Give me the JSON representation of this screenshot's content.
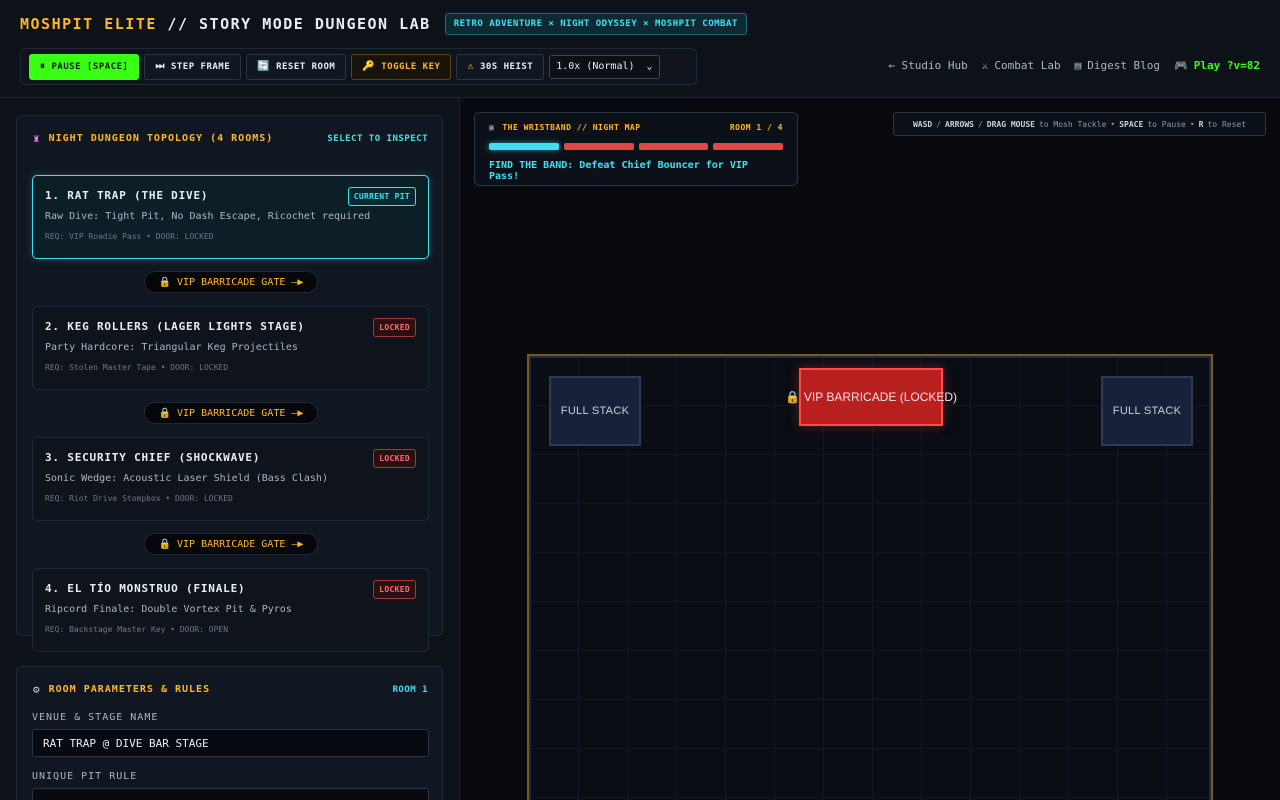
{
  "header": {
    "brand": "MOSHPIT ELITE",
    "title_rest": " // STORY MODE DUNGEON LAB",
    "tagline": "RETRO ADVENTURE × NIGHT ODYSSEY × MOSHPIT COMBAT"
  },
  "toolbar": {
    "pause": "PAUSE [SPACE]",
    "step": "STEP FRAME",
    "reset": "RESET ROOM",
    "toggle_key": "TOGGLE KEY",
    "heist": "30S HEIST",
    "speed": "1.0x (Normal)"
  },
  "nav": {
    "studio": "← Studio Hub",
    "combat": "Combat Lab",
    "digest": "Digest Blog",
    "play": "Play ?v=82"
  },
  "topology": {
    "title": "NIGHT DUNGEON TOPOLOGY (4 ROOMS)",
    "hint": "SELECT TO INSPECT",
    "gate_label": "VIP BARRICADE GATE",
    "rooms": [
      {
        "name": "1. RAT TRAP (THE DIVE)",
        "desc": "Raw Dive: Tight Pit, No Dash Escape, Ricochet required",
        "req": "REQ: VIP Roadie Pass  •  DOOR: LOCKED",
        "badge": "CURRENT PIT"
      },
      {
        "name": "2. KEG ROLLERS (LAGER LIGHTS STAGE)",
        "desc": "Party Hardcore: Triangular Keg Projectiles",
        "req": "REQ: Stolen Master Tape  •  DOOR: LOCKED",
        "badge": "LOCKED"
      },
      {
        "name": "3. SECURITY CHIEF (SHOCKWAVE)",
        "desc": "Sonic Wedge: Acoustic Laser Shield (Bass Clash)",
        "req": "REQ: Riot Drive Stompbox  •  DOOR: LOCKED",
        "badge": "LOCKED"
      },
      {
        "name": "4. EL TÍO MONSTRUO (FINALE)",
        "desc": "Ripcord Finale: Double Vortex Pit & Pyros",
        "req": "REQ: Backstage Master Key  •  DOOR: OPEN",
        "badge": "LOCKED"
      }
    ]
  },
  "params": {
    "title": "ROOM PARAMETERS & RULES",
    "room": "ROOM 1",
    "venue_label": "VENUE & STAGE NAME",
    "venue_value": "RAT TRAP @ DIVE BAR STAGE",
    "rule_label": "UNIQUE PIT RULE"
  },
  "map": {
    "title": "THE WRISTBAND // NIGHT MAP",
    "room": "ROOM 1 / 4",
    "progress_current": 1,
    "progress_total": 4,
    "objective": "FIND THE BAND: Defeat Chief Bouncer for VIP Pass!"
  },
  "controls": {
    "k1": "WASD",
    "k2": "ARROWS",
    "k3": "DRAG MOUSE",
    "t1": "to Mosh Tackle",
    "k4": "SPACE",
    "t2": "to Pause",
    "k5": "R",
    "t3": "to Reset"
  },
  "arena": {
    "stack_left": "FULL STACK",
    "stack_right": "FULL STACK",
    "barricade": "VIP BARRICADE (LOCKED)"
  },
  "icons": {
    "pause": "pause-icon",
    "step": "skip-icon",
    "reset": "reset-icon",
    "key": "key-icon",
    "warning": "warning-icon",
    "lock": "lock-icon"
  },
  "colors": {
    "accent_green": "#39ff14",
    "accent_cyan": "#3ee0f0",
    "accent_amber": "#ffb627",
    "danger": "#e04848"
  }
}
